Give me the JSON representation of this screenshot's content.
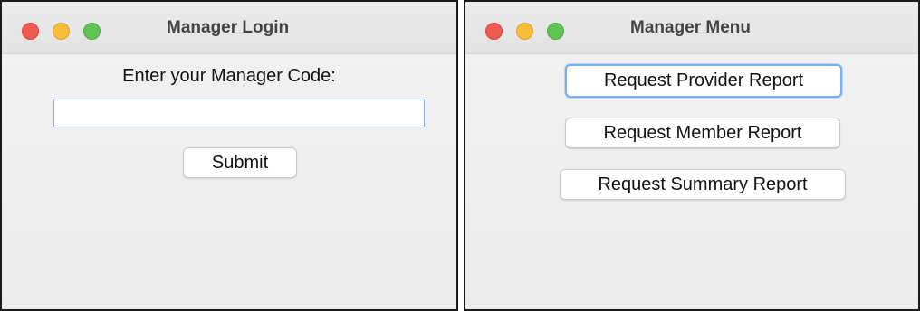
{
  "login_window": {
    "title": "Manager Login",
    "prompt": "Enter your Manager Code:",
    "code_input": {
      "value": "",
      "placeholder": ""
    },
    "submit_label": "Submit"
  },
  "menu_window": {
    "title": "Manager Menu",
    "buttons": [
      {
        "label": "Request Provider Report",
        "focused": true
      },
      {
        "label": "Request Member Report",
        "focused": false
      },
      {
        "label": "Request Summary Report",
        "focused": false
      }
    ]
  },
  "colors": {
    "close": "#ee5b53",
    "minimize": "#f6bd3b",
    "maximize": "#5fc454",
    "focus_ring": "#7aaef0"
  },
  "icons": [
    "close-icon",
    "minimize-icon",
    "maximize-icon"
  ]
}
